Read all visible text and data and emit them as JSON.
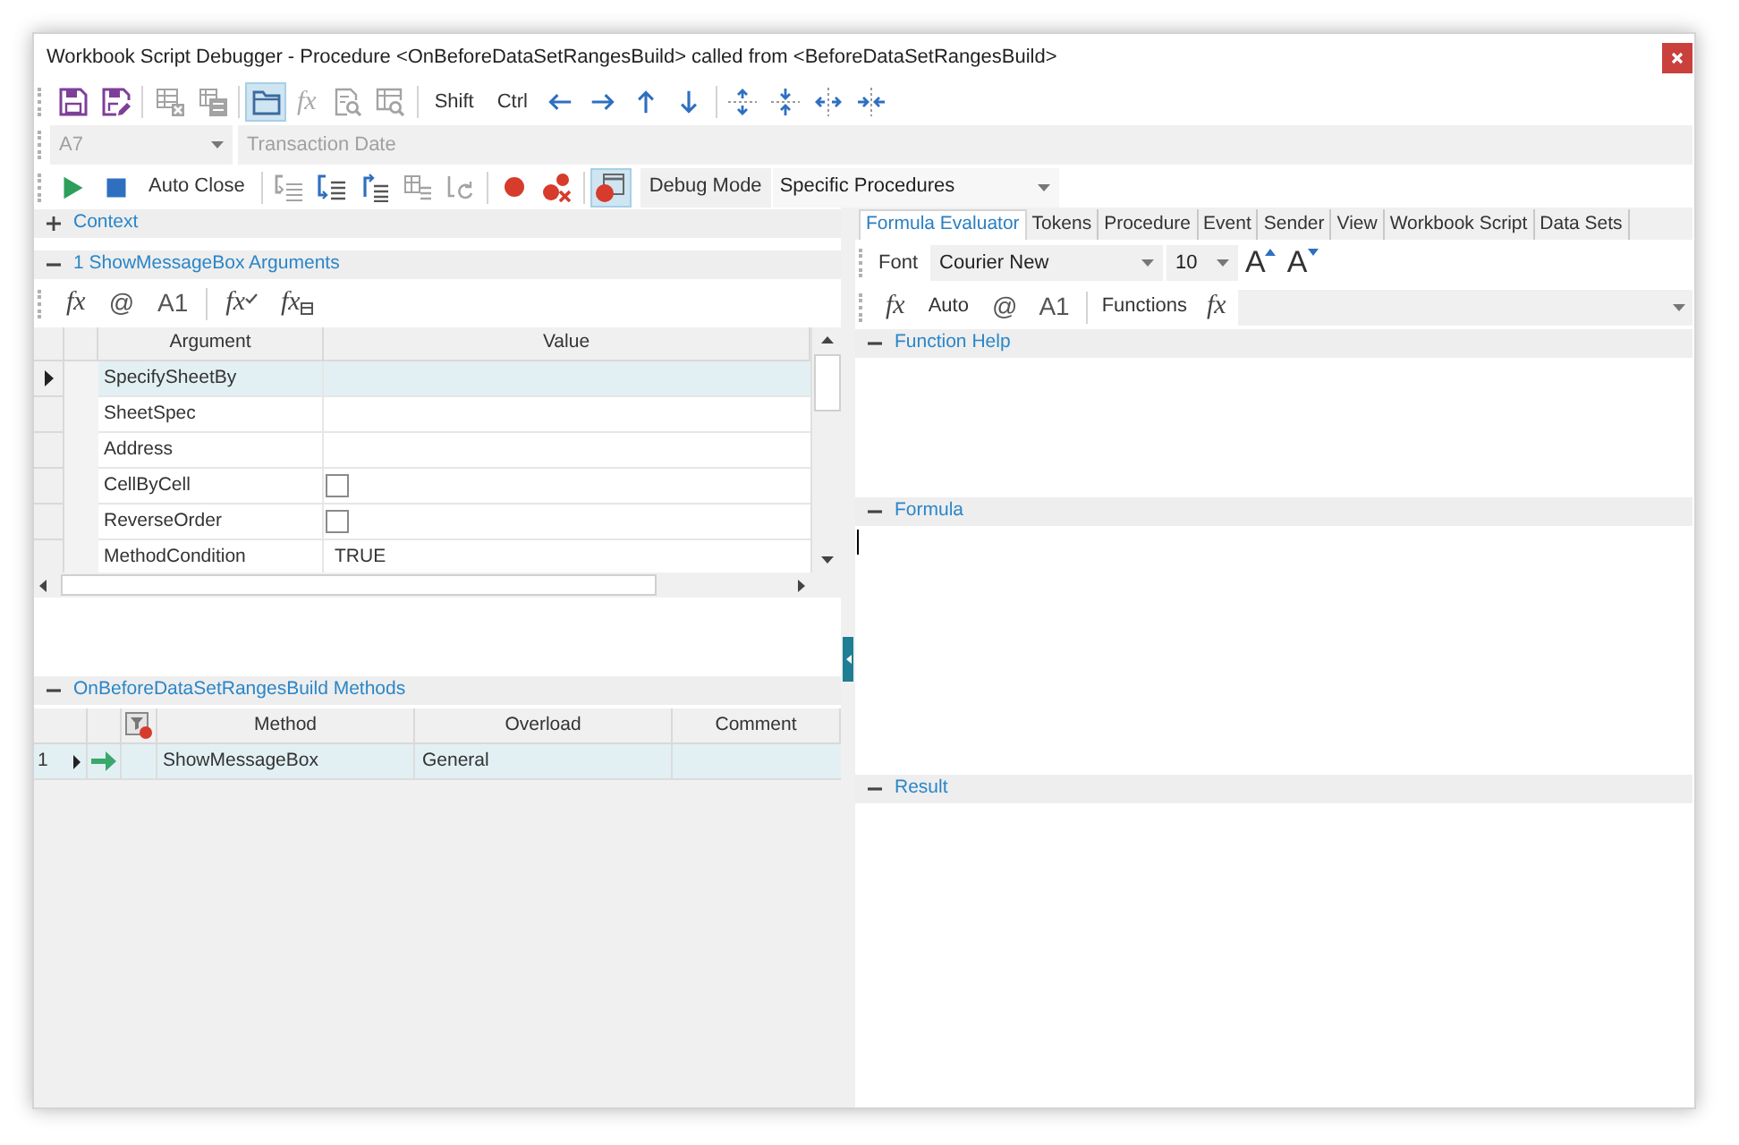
{
  "window": {
    "title": "Workbook Script Debugger - Procedure <OnBeforeDataSetRangesBuild> called from <BeforeDataSetRangesBuild>"
  },
  "main_toolbar": [
    [
      {
        "kind": "icon",
        "disabled": false,
        "on": false
      },
      {
        "kind": "icon",
        "disabled": false,
        "on": false
      }
    ],
    [
      {
        "kind": "icon",
        "disabled": true,
        "on": false
      },
      {
        "kind": "icon",
        "disabled": true,
        "on": false
      }
    ],
    [
      {
        "kind": "icon",
        "disabled": false,
        "on": true
      },
      {
        "kind": "symbol",
        "label": "fx",
        "disabled": true,
        "on": false
      },
      {
        "kind": "icon",
        "disabled": true,
        "on": false
      },
      {
        "kind": "icon",
        "disabled": true,
        "on": false
      }
    ],
    [
      {
        "kind": "text",
        "label": "Shift",
        "disabled": false,
        "on": false
      },
      {
        "kind": "text",
        "label": "Ctrl",
        "disabled": false,
        "on": false
      },
      {
        "kind": "icon",
        "disabled": false,
        "on": false
      },
      {
        "kind": "icon",
        "disabled": false,
        "on": false
      },
      {
        "kind": "icon",
        "disabled": false,
        "on": false
      },
      {
        "kind": "icon",
        "disabled": false,
        "on": false
      }
    ],
    [
      {
        "kind": "icon",
        "disabled": false,
        "on": false
      },
      {
        "kind": "icon",
        "disabled": false,
        "on": false
      },
      {
        "kind": "icon",
        "disabled": false,
        "on": false
      },
      {
        "kind": "icon",
        "disabled": false,
        "on": false
      }
    ]
  ],
  "cell_bar": {
    "cell": "A7",
    "description": "Transaction Date",
    "disabled": true
  },
  "debug_toolbar": [
    [
      {
        "kind": "icon",
        "disabled": false,
        "on": false
      },
      {
        "kind": "icon",
        "disabled": false,
        "on": false
      },
      {
        "kind": "text",
        "label": "Auto Close",
        "disabled": false,
        "on": false
      }
    ],
    [
      {
        "kind": "icon",
        "disabled": true,
        "on": false
      },
      {
        "kind": "icon",
        "disabled": false,
        "on": false
      },
      {
        "kind": "icon",
        "disabled": false,
        "on": false
      },
      {
        "kind": "icon",
        "disabled": true,
        "on": false
      },
      {
        "kind": "icon",
        "disabled": true,
        "on": false
      }
    ],
    [
      {
        "kind": "icon",
        "disabled": false,
        "on": false
      },
      {
        "kind": "icon",
        "disabled": false,
        "on": false
      }
    ],
    [
      {
        "kind": "icon",
        "disabled": false,
        "on": true
      }
    ]
  ],
  "debug_mode": {
    "label": "Debug Mode",
    "value": "Specific Procedures"
  },
  "context": {
    "title": "Context",
    "expanded": false
  },
  "arguments": {
    "title": "1 ShowMessageBox Arguments",
    "expanded": true,
    "toolbar": [
      [
        {
          "kind": "symbol",
          "label": "fx"
        },
        {
          "kind": "glyph",
          "label": "@"
        },
        {
          "kind": "glyph",
          "label": "A1"
        }
      ],
      [
        {
          "kind": "symbol-check",
          "label": "fx"
        },
        {
          "kind": "symbol-table",
          "label": "fx"
        }
      ]
    ],
    "columns": [
      "Argument",
      "Value"
    ],
    "rows": [
      {
        "argument": "SpecifySheetBy",
        "kind": "text",
        "selected": true
      },
      {
        "argument": "SheetSpec",
        "kind": "text",
        "selected": false
      },
      {
        "argument": "Address",
        "kind": "text",
        "selected": false
      },
      {
        "argument": "CellByCell",
        "kind": "checkbox",
        "checked": false,
        "selected": false
      },
      {
        "argument": "ReverseOrder",
        "kind": "checkbox",
        "checked": false,
        "selected": false
      },
      {
        "argument": "MethodCondition",
        "kind": "text",
        "value": "TRUE",
        "selected": false
      }
    ]
  },
  "methods": {
    "title": "OnBeforeDataSetRangesBuild Methods",
    "expanded": true,
    "columns": [
      "Method",
      "Overload",
      "Comment"
    ],
    "rows": [
      {
        "number": "1",
        "method": "ShowMessageBox",
        "overload": "General",
        "selected": true,
        "current": true
      }
    ]
  },
  "tabs": [
    {
      "label": "Formula Evaluator",
      "selected": true
    },
    {
      "label": "Tokens",
      "selected": false
    },
    {
      "label": "Procedure",
      "selected": false
    },
    {
      "label": "Event",
      "selected": false
    },
    {
      "label": "Sender",
      "selected": false
    },
    {
      "label": "View",
      "selected": false
    },
    {
      "label": "Workbook Script",
      "selected": false
    },
    {
      "label": "Data Sets",
      "selected": false
    }
  ],
  "font_bar": {
    "label": "Font",
    "font": "Courier New",
    "size": "10",
    "grow": "A",
    "shrink": "A"
  },
  "formula_bar": {
    "tools": [
      {
        "kind": "symbol",
        "label": "fx"
      },
      {
        "kind": "text",
        "label": "Auto"
      },
      {
        "kind": "glyph",
        "label": "@"
      },
      {
        "kind": "glyph",
        "label": "A1"
      }
    ],
    "functions_label": "Functions",
    "functions_symbol": "fx"
  },
  "sections": [
    {
      "title": "Function Help",
      "kind": "help",
      "expanded": true
    },
    {
      "title": "Formula",
      "kind": "editor",
      "expanded": true
    },
    {
      "title": "Result",
      "kind": "result",
      "expanded": true
    }
  ]
}
